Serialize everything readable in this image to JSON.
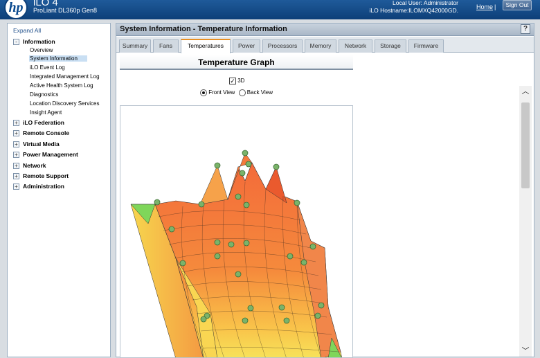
{
  "header": {
    "logo": "hp",
    "product_name": "iLO 4",
    "product_model": "ProLiant DL360p Gen8",
    "local_user": "Local User:  Administrator",
    "hostname": "iLO Hostname:ILOMXQ42000GD.",
    "home_link": "Home",
    "separator": "|",
    "sign_out": "Sign Out"
  },
  "nav": {
    "expand_all": "Expand All",
    "groups": [
      {
        "label": "Information",
        "toggle": "-",
        "expanded": true,
        "items": [
          "Overview",
          "System Information",
          "iLO Event Log",
          "Integrated Management Log",
          "Active Health System Log",
          "Diagnostics",
          "Location Discovery Services",
          "Insight Agent"
        ],
        "selected": "System Information"
      },
      {
        "label": "iLO Federation",
        "toggle": "+"
      },
      {
        "label": "Remote Console",
        "toggle": "+"
      },
      {
        "label": "Virtual Media",
        "toggle": "+"
      },
      {
        "label": "Power Management",
        "toggle": "+"
      },
      {
        "label": "Network",
        "toggle": "+"
      },
      {
        "label": "Remote Support",
        "toggle": "+"
      },
      {
        "label": "Administration",
        "toggle": "+"
      }
    ]
  },
  "panel": {
    "title": "System Information - Temperature Information",
    "help": "?"
  },
  "tabs": [
    "Summary",
    "Fans",
    "Temperatures",
    "Power",
    "Processors",
    "Memory",
    "Network",
    "Storage",
    "Firmware"
  ],
  "active_tab": "Temperatures",
  "graph": {
    "title": "Temperature Graph",
    "checkbox_3d_label": "3D",
    "checkbox_3d_checked": true,
    "front_view_label": "Front View",
    "back_view_label": "Back View",
    "selected_view": "Front View"
  },
  "colors": {
    "header_blue": "#0d3f78",
    "tab_accent": "#e88f22",
    "nav_selected": "#c9dff3"
  }
}
